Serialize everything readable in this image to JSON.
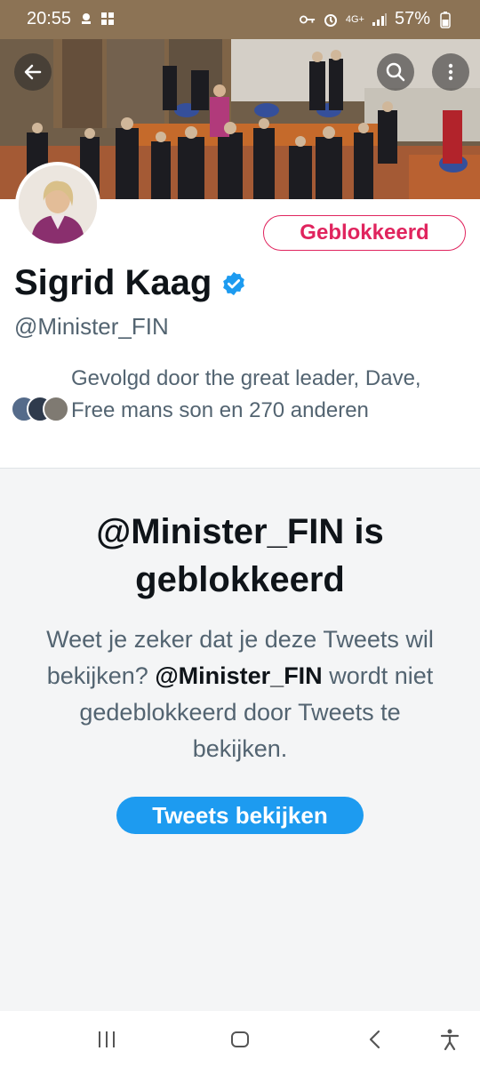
{
  "status_bar": {
    "time": "20:55",
    "network": "4G+",
    "battery": "57%",
    "icons": [
      "notification-icon",
      "gallery-icon",
      "key-icon",
      "alarm-icon",
      "signal-icon",
      "battery-icon"
    ]
  },
  "header": {
    "back_icon": "arrow-left-icon",
    "search_icon": "search-icon",
    "more_icon": "more-vertical-icon"
  },
  "profile": {
    "name": "Sigrid Kaag",
    "handle": "@Minister_FIN",
    "verified": true,
    "blocked_label": "Geblokkeerd",
    "followed_by": "Gevolgd door the great leader, Dave, Free mans son en 270 anderen"
  },
  "blocked_notice": {
    "title": "@Minister_FIN is geblokkeerd",
    "desc_part1": "Weet je zeker dat je deze Tweets wil bekijken? ",
    "desc_handle": "@Minister_FIN",
    "desc_part2": " wordt niet gedeblokkeerd door Tweets te bekijken.",
    "button_label": "Tweets bekijken"
  },
  "nav": {
    "items": [
      "recent-apps-icon",
      "home-icon",
      "back-icon",
      "accessibility-icon"
    ]
  },
  "colors": {
    "status_bar": "#8c7355",
    "accent_blue": "#1d9bf0",
    "blocked_red": "#e0245e",
    "secondary_text": "#536471",
    "notice_bg": "#f4f5f6"
  }
}
